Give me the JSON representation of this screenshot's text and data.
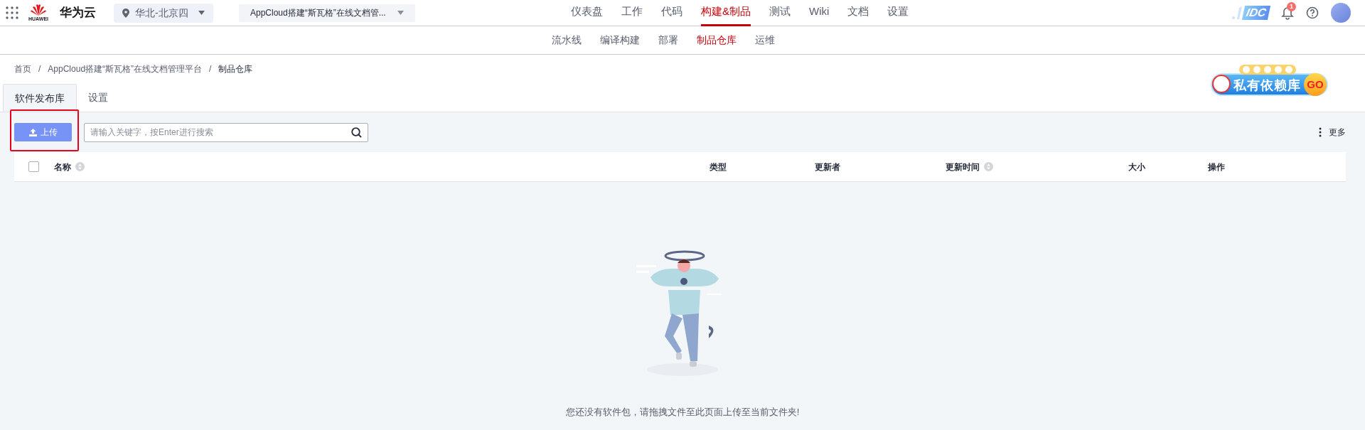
{
  "header": {
    "logo_text": "HUAWEI",
    "brand": "华为云",
    "region": "华北-北京四",
    "project": "AppCloud搭建“斯瓦格”在线文档管...",
    "nav": [
      {
        "label": "仪表盘",
        "selected": false
      },
      {
        "label": "工作",
        "selected": false
      },
      {
        "label": "代码",
        "selected": false
      },
      {
        "label": "构建&制品",
        "selected": true
      },
      {
        "label": "测试",
        "selected": false
      },
      {
        "label": "Wiki",
        "selected": false
      },
      {
        "label": "文档",
        "selected": false
      },
      {
        "label": "设置",
        "selected": false
      }
    ],
    "partner_logo": "IDC",
    "notification_count": "1"
  },
  "subnav": [
    {
      "label": "流水线",
      "selected": false
    },
    {
      "label": "编译构建",
      "selected": false
    },
    {
      "label": "部署",
      "selected": false
    },
    {
      "label": "制品仓库",
      "selected": true
    },
    {
      "label": "运维",
      "selected": false
    }
  ],
  "breadcrumb": [
    {
      "kind": "link",
      "text": "首页"
    },
    {
      "kind": "separator",
      "text": "/"
    },
    {
      "kind": "link",
      "text": "AppCloud搭建“斯瓦格”在线文档管理平台"
    },
    {
      "kind": "separator",
      "text": "/"
    },
    {
      "kind": "current",
      "text": "制品仓库"
    }
  ],
  "banner": {
    "title": "私有依赖库",
    "go": "GO"
  },
  "tabs": [
    {
      "label": "软件发布库",
      "selected": true
    },
    {
      "label": "设置",
      "selected": false
    }
  ],
  "toolbar": {
    "upload": "上传",
    "search": {
      "placeholder": "请输入关键字，按Enter进行搜索"
    },
    "more": "更多"
  },
  "table": {
    "select_all": {
      "checked": false
    },
    "columns": [
      {
        "label": "名称",
        "sortable": true
      },
      {
        "label": "类型",
        "sortable": false
      },
      {
        "label": "更新者",
        "sortable": false
      },
      {
        "label": "更新时间",
        "sortable": true
      },
      {
        "label": "大小",
        "sortable": false
      },
      {
        "label": "操作",
        "sortable": false
      }
    ]
  },
  "empty_message": "您还没有软件包，请拖拽文件至此页面上传至当前文件夹!"
}
